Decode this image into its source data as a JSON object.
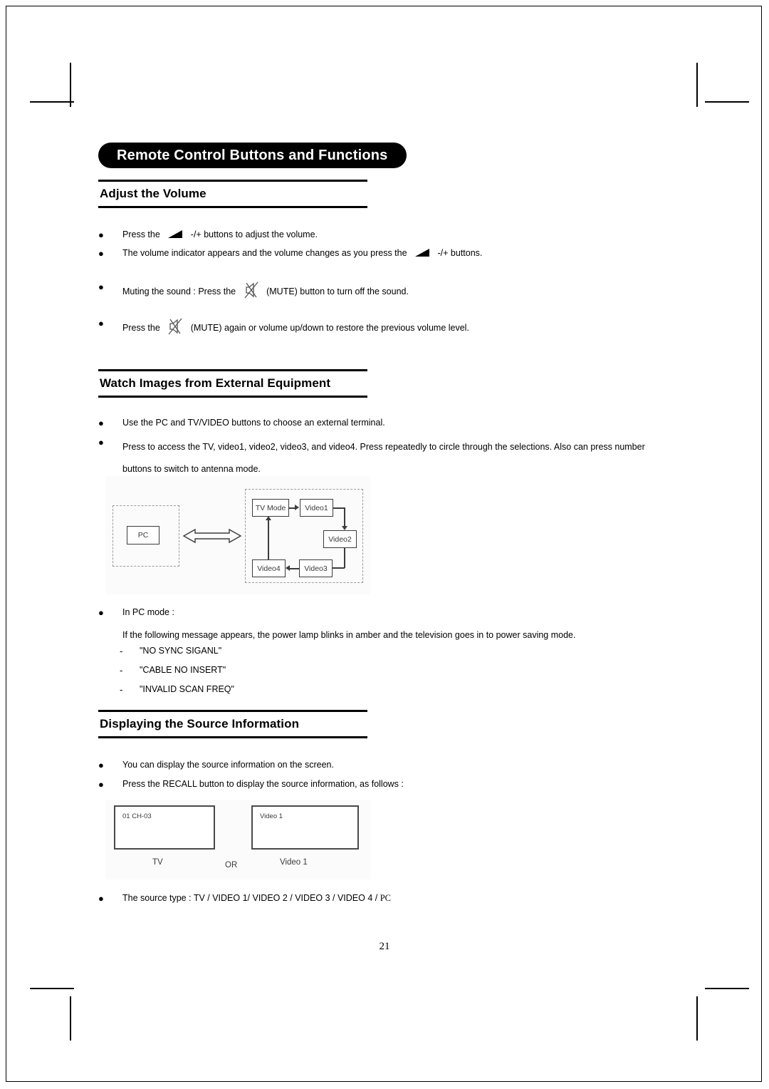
{
  "document": {
    "page_number": "21",
    "banner_title": "Remote Control Buttons and Functions"
  },
  "sections": [
    {
      "id": "adjust-volume",
      "title": "Adjust the Volume",
      "items": [
        {
          "type": "bullet",
          "bullet": "●",
          "before": "Press the",
          "icon": "volume-icon",
          "after": "-/+ buttons to adjust the volume."
        },
        {
          "type": "bullet",
          "bullet": "●",
          "before": "The volume indicator appears and the volume changes as you press the",
          "icon": "volume-icon",
          "after": "-/+ buttons."
        },
        {
          "type": "bullet",
          "bullet": "●",
          "before": "Muting the sound : Press the",
          "icon": "mute-icon",
          "after": "(MUTE) button to turn off the sound."
        },
        {
          "type": "bullet",
          "bullet": "●",
          "before": "Press the",
          "icon": "mute-icon",
          "after": "(MUTE) again or volume up/down to restore the previous volume level."
        }
      ]
    },
    {
      "id": "watch-images",
      "title": "Watch Images from External Equipment",
      "items": [
        {
          "type": "bullet",
          "bullet": "●",
          "text": "Use the PC and TV/VIDEO buttons to choose an external terminal."
        },
        {
          "type": "bullet",
          "bullet": "●",
          "text": "Press to access the TV, video1, video2, video3, and video4. Press repeatedly to circle through the selections. Also can press number buttons to switch to antenna mode."
        },
        {
          "type": "bullet",
          "bullet": "●",
          "text": "In PC mode :"
        },
        {
          "type": "para",
          "text": "If the following message appears, the power lamp blinks in amber and the television goes in to power saving mode."
        },
        {
          "type": "dash",
          "dash": "-",
          "text": "\"NO SYNC SIGANL\""
        },
        {
          "type": "dash",
          "dash": "-",
          "text": "\"CABLE NO INSERT\""
        },
        {
          "type": "dash",
          "dash": "-",
          "text": "\"INVALID SCAN FREQ\""
        }
      ]
    },
    {
      "id": "source-info",
      "title": "Displaying the Source Information",
      "items": [
        {
          "type": "bullet",
          "bullet": "●",
          "text": "You can display the source information on the screen."
        },
        {
          "type": "bullet",
          "bullet": "●",
          "text": "Press the RECALL button to display the source information, as follows :"
        },
        {
          "type": "bullet",
          "bullet": "●",
          "before": "The source type : TV / VIDEO 1/ VIDEO 2 / VIDEO 3 / VIDEO 4 / ",
          "serif_tail": "PC"
        }
      ]
    }
  ],
  "figures": {
    "source_switch": {
      "pc_label": "PC",
      "nodes": [
        {
          "id": "tv-mode",
          "label": "TV Mode"
        },
        {
          "id": "video1",
          "label": "Video1"
        },
        {
          "id": "video2",
          "label": "Video2"
        },
        {
          "id": "video3",
          "label": "Video3"
        },
        {
          "id": "video4",
          "label": "Video4"
        }
      ]
    },
    "osd_recall": {
      "left_screen_text": "01   CH-03",
      "left_caption": "TV",
      "separator": "OR",
      "right_screen_text": "Video 1",
      "right_caption": "Video 1"
    }
  }
}
